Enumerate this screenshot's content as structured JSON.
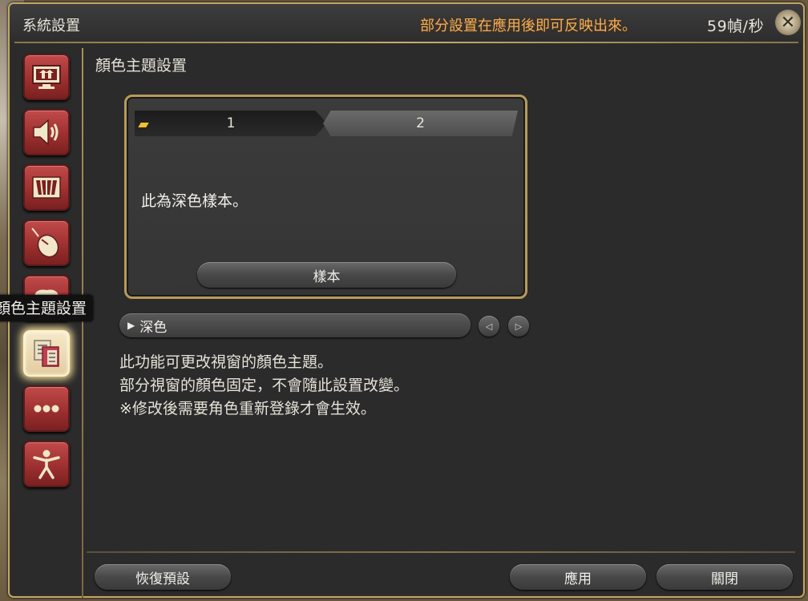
{
  "window": {
    "title": "系統設置",
    "notice": "部分設置在應用後即可反映出來。",
    "fps": "59幀/秒"
  },
  "sidebar": {
    "items": [
      {
        "icon": "display-icon"
      },
      {
        "icon": "speaker-icon"
      },
      {
        "icon": "equalizer-icon"
      },
      {
        "icon": "mouse-icon"
      },
      {
        "icon": "gamepad-icon"
      },
      {
        "icon": "theme-icon",
        "active": true
      },
      {
        "icon": "ellipsis-icon"
      },
      {
        "icon": "accessibility-icon"
      }
    ],
    "tooltip": "顏色主題設置"
  },
  "content": {
    "section_title": "顏色主題設置",
    "preview": {
      "tabs": [
        "1",
        "2"
      ],
      "sample_text": "此為深色樣本。",
      "sample_button": "樣本"
    },
    "dropdown_value": "深色",
    "description": [
      "此功能可更改視窗的顏色主題。",
      "部分視窗的顏色固定，不會隨此設置改變。",
      "※修改後需要角色重新登錄才會生效。"
    ]
  },
  "footer": {
    "reset": "恢復預設",
    "apply": "應用",
    "close": "關閉"
  },
  "colors": {
    "accent_gold": "#bfa76a",
    "notice": "#f0b060",
    "nav_red": "#9a2e2e"
  }
}
